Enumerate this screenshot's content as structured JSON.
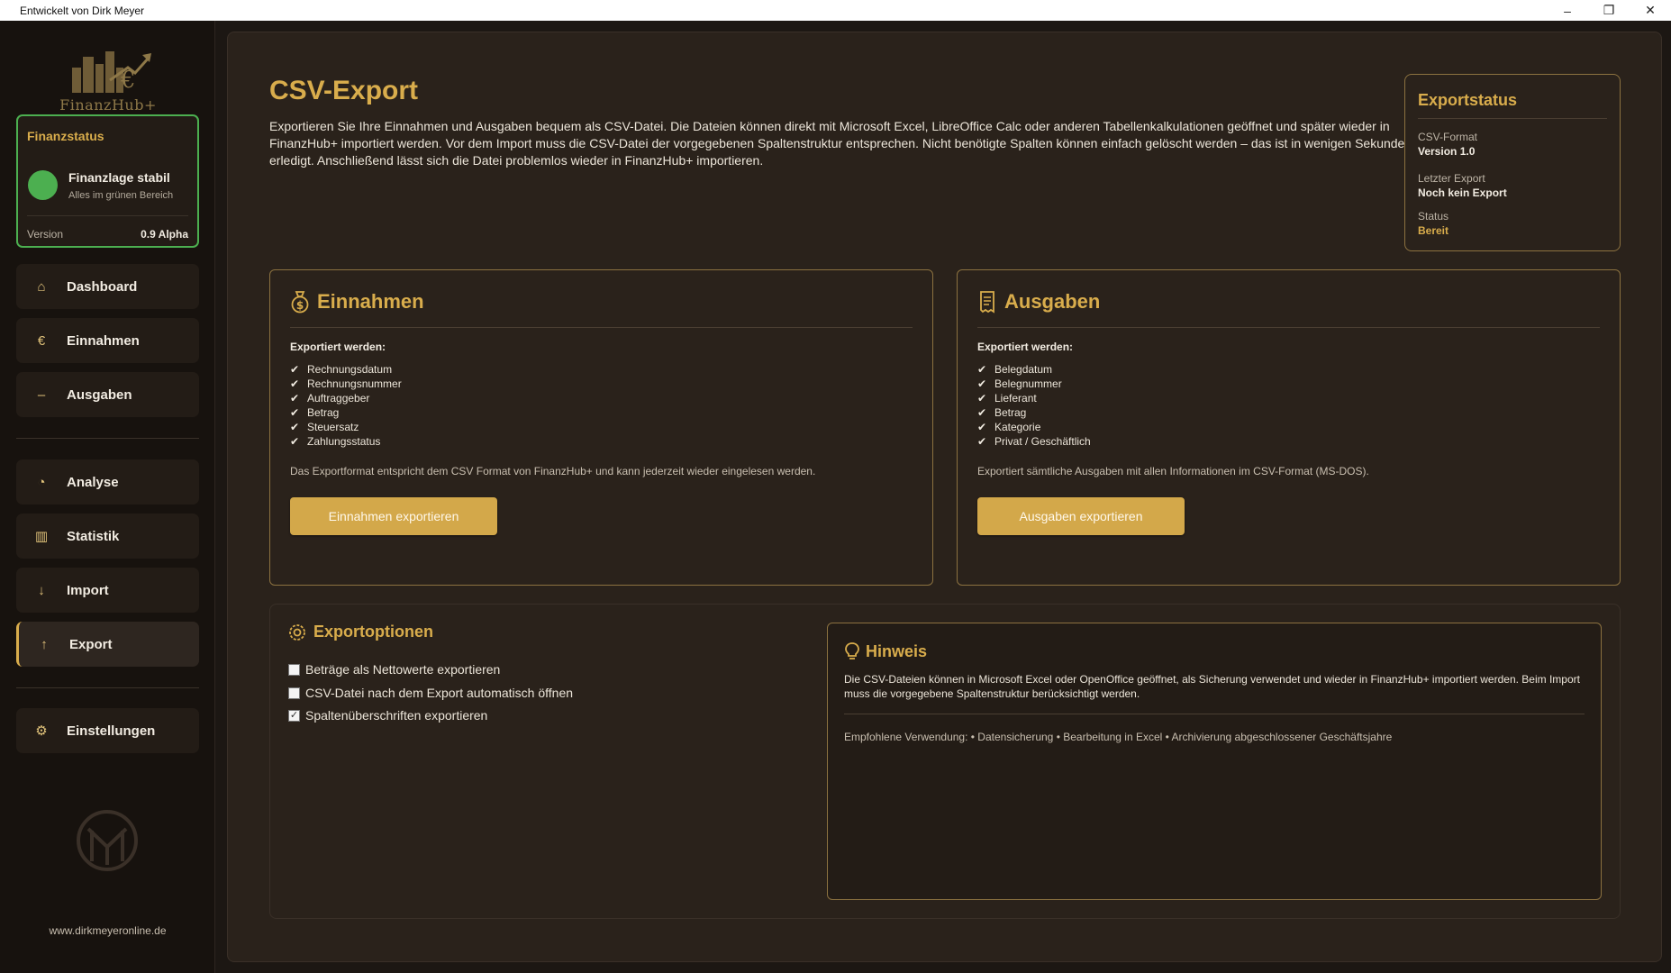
{
  "window": {
    "title": "Entwickelt von Dirk Meyer",
    "min": "–",
    "max": "❐",
    "close": "✕"
  },
  "sidebar": {
    "logo_text": "FinanzHub+",
    "status": {
      "heading": "Finanzstatus",
      "main": "Finanzlage stabil",
      "sub": "Alles im grünen Bereich",
      "version_label": "Version",
      "version_value": "0.9 Alpha",
      "status_color": "#4caf50"
    },
    "nav": [
      {
        "label": "Dashboard",
        "icon": "⌂",
        "icon_name": "home-icon"
      },
      {
        "label": "Einnahmen",
        "icon": "€",
        "icon_name": "euro-icon"
      },
      {
        "label": "Ausgaben",
        "icon": "–",
        "icon_name": "minus-icon"
      },
      {
        "label": "Analyse",
        "icon": "◔",
        "icon_name": "pie-chart-icon"
      },
      {
        "label": "Statistik",
        "icon": "▥",
        "icon_name": "bar-chart-icon"
      },
      {
        "label": "Import",
        "icon": "↓",
        "icon_name": "arrow-down-icon"
      },
      {
        "label": "Export",
        "icon": "↑",
        "icon_name": "arrow-up-icon"
      },
      {
        "label": "Einstellungen",
        "icon": "⚙",
        "icon_name": "gear-icon"
      }
    ],
    "footer_url": "www.dirkmeyeronline.de"
  },
  "main": {
    "title": "CSV-Export",
    "description": "Exportieren Sie Ihre Einnahmen und Ausgaben bequem als CSV-Datei. Die Dateien können direkt mit Microsoft Excel, LibreOffice Calc oder anderen Tabellenkalkulationen geöffnet und später wieder in FinanzHub+ importiert werden. Vor dem Import muss die CSV-Datei der vorgegebenen Spaltenstruktur entsprechen. Nicht benötigte Spalten können einfach gelöscht werden – das ist in wenigen Sekunden erledigt. Anschließend lässt sich die Datei problemlos wieder in FinanzHub+ importieren.",
    "export_status": {
      "heading": "Exportstatus",
      "format_label": "CSV-Format",
      "format_value": "Version 1.0",
      "last_label": "Letzter Export",
      "last_value": "Noch kein Export",
      "status_label": "Status",
      "status_value": "Bereit"
    },
    "income": {
      "title": "Einnahmen",
      "subtitle": "Exportiert werden:",
      "items": [
        "Rechnungsdatum",
        "Rechnungsnummer",
        "Auftraggeber",
        "Betrag",
        "Steuersatz",
        "Zahlungsstatus"
      ],
      "note": "Das Exportformat entspricht dem CSV Format von FinanzHub+ und kann jederzeit wieder eingelesen werden.",
      "button": "Einnahmen exportieren"
    },
    "expenses": {
      "title": "Ausgaben",
      "subtitle": "Exportiert werden:",
      "items": [
        "Belegdatum",
        "Belegnummer",
        "Lieferant",
        "Betrag",
        "Kategorie",
        "Privat / Geschäftlich"
      ],
      "note": "Exportiert sämtliche Ausgaben mit allen Informationen im CSV-Format (MS-DOS).",
      "button": "Ausgaben exportieren"
    },
    "options": {
      "title": "Exportoptionen",
      "items": [
        {
          "label": "Beträge als Nettowerte exportieren",
          "checked": false
        },
        {
          "label": "CSV-Datei nach dem Export automatisch öffnen",
          "checked": false
        },
        {
          "label": "Spaltenüberschriften exportieren",
          "checked": true
        }
      ]
    },
    "hint": {
      "title": "Hinweis",
      "text": "Die CSV-Dateien können in Microsoft Excel oder OpenOffice geöffnet, als Sicherung verwendet und wieder in FinanzHub+ importiert werden. Beim Import muss die vorgegebene Spaltenstruktur berücksichtigt werden.",
      "recommend": "Empfohlene Verwendung: • Datensicherung • Bearbeitung in Excel • Archivierung abgeschlossener Geschäftsjahre"
    }
  },
  "colors": {
    "accent": "#d9ad4c",
    "button": "#d3a84a",
    "border": "#8c7240",
    "background": "#1c1713"
  }
}
